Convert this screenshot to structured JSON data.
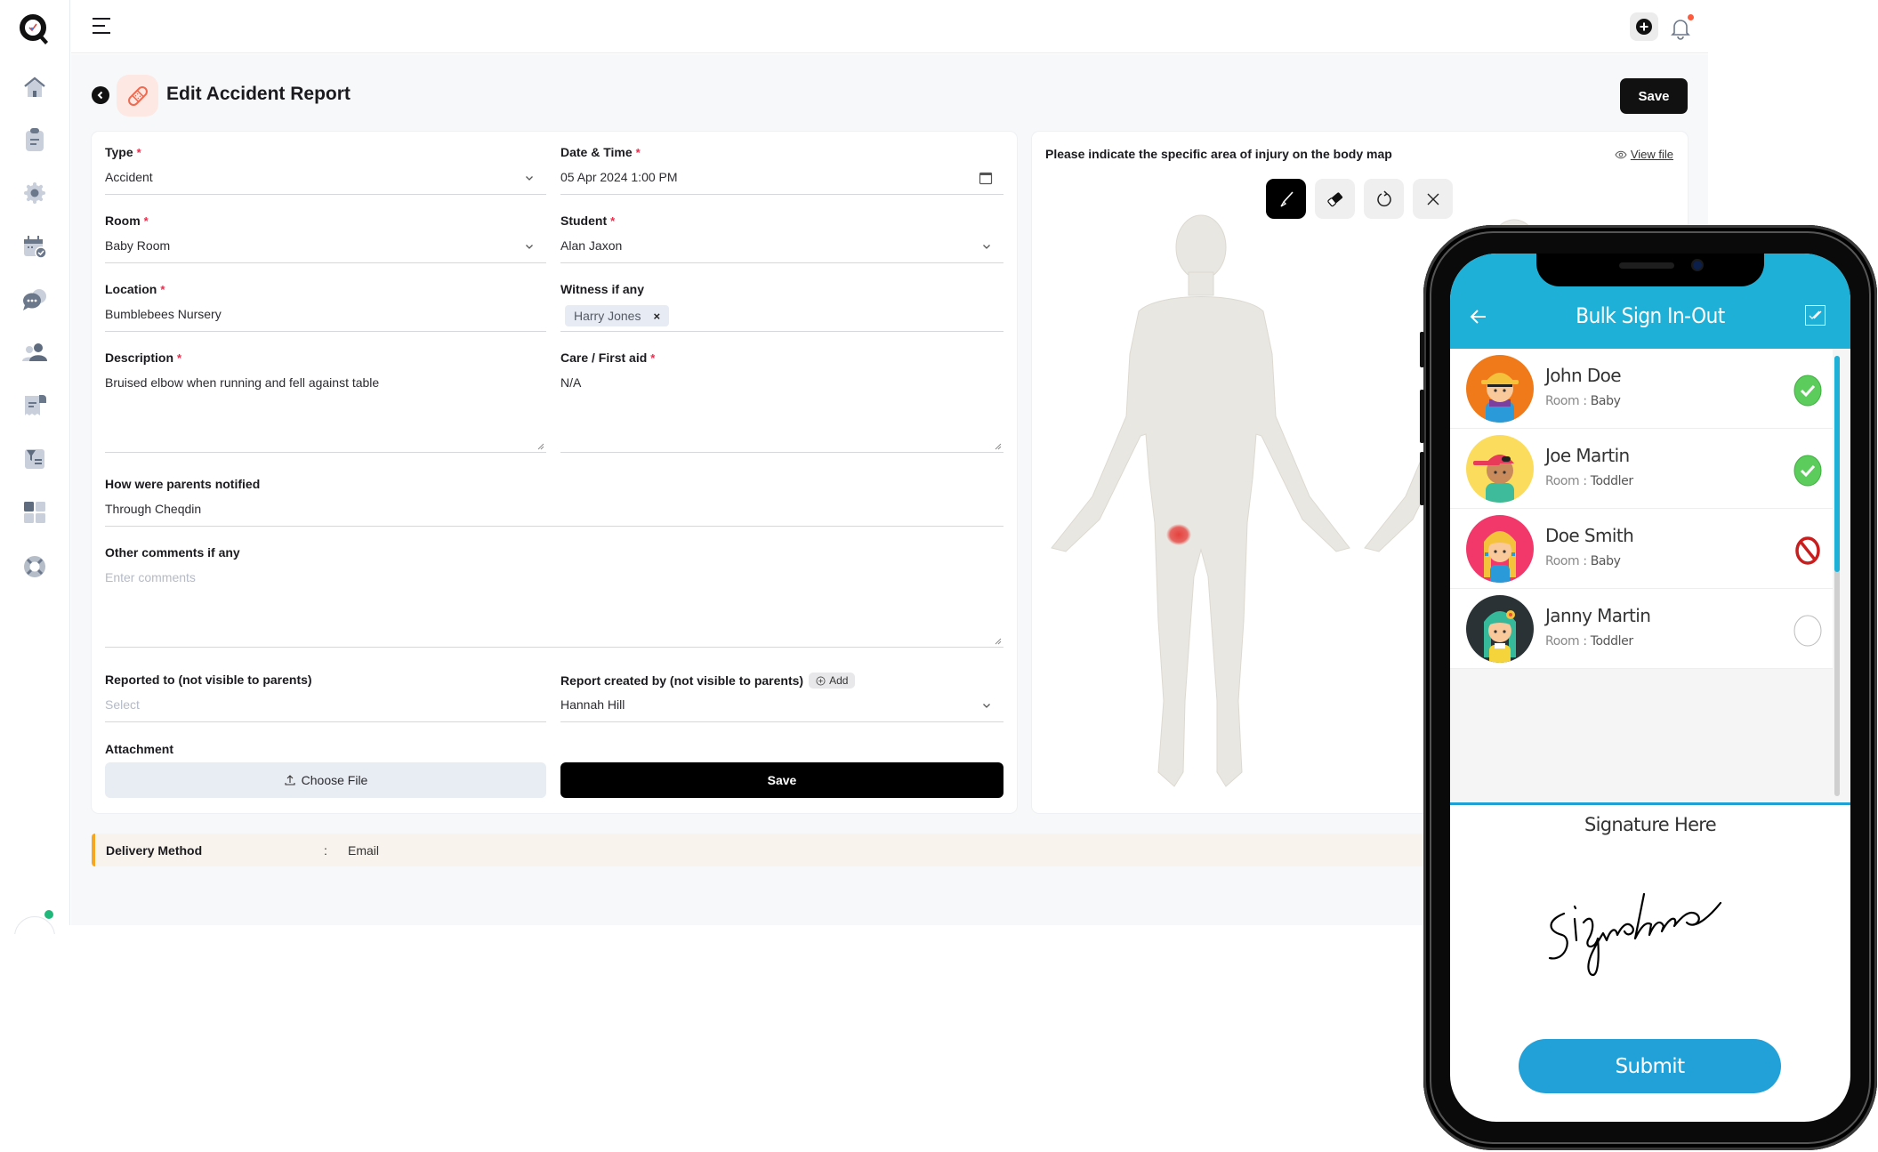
{
  "app": {
    "title": "Edit Accident Report",
    "sidebar": {
      "items": [
        {
          "icon": "home-icon"
        },
        {
          "icon": "clipboard-icon"
        },
        {
          "icon": "settings-icon"
        },
        {
          "icon": "calendar-check-icon"
        },
        {
          "icon": "chat-icon"
        },
        {
          "icon": "users-icon"
        },
        {
          "icon": "receipt-icon"
        },
        {
          "icon": "filter-list-icon"
        },
        {
          "icon": "dashboard-grid-icon"
        },
        {
          "icon": "support-lifebuoy-icon"
        }
      ]
    },
    "topbar": {
      "add_icon": "plus-circle-icon",
      "bell_icon": "bell-icon",
      "notification_dot": true
    },
    "header": {
      "save_label": "Save"
    }
  },
  "form": {
    "type": {
      "label": "Type",
      "required": "*",
      "value": "Accident"
    },
    "datetime": {
      "label": "Date & Time",
      "required": "*",
      "value": "05 Apr 2024 1:00 PM"
    },
    "room": {
      "label": "Room",
      "required": "*",
      "value": "Baby Room"
    },
    "student": {
      "label": "Student",
      "required": "*",
      "value": "Alan Jaxon"
    },
    "location": {
      "label": "Location",
      "required": "*",
      "value": "Bumblebees Nursery"
    },
    "witness": {
      "label": "Witness if any",
      "chips": [
        "Harry Jones"
      ],
      "chip_remove": "×"
    },
    "description": {
      "label": "Description",
      "required": "*",
      "value": "Bruised elbow when running and fell against table"
    },
    "care": {
      "label": "Care / First aid",
      "required": "*",
      "value": "N/A"
    },
    "parents_notified": {
      "label": "How were parents notified",
      "value": "Through Cheqdin"
    },
    "comments": {
      "label": "Other comments if any",
      "placeholder": "Enter comments",
      "value": ""
    },
    "reported_to": {
      "label": "Reported to (not visible to parents)",
      "placeholder": "Select",
      "value": ""
    },
    "created_by": {
      "label": "Report created by (not visible to parents)",
      "add_label": "Add",
      "value": "Hannah Hill"
    },
    "attachment": {
      "label": "Attachment",
      "choose_label": "Choose File"
    },
    "save_label": "Save"
  },
  "body_map": {
    "prompt": "Please indicate the specific area of injury on the body map",
    "view_file": "View file",
    "tools": [
      {
        "name": "brush",
        "active": true
      },
      {
        "name": "eraser",
        "active": false
      },
      {
        "name": "undo",
        "active": false
      },
      {
        "name": "clear",
        "active": false
      }
    ],
    "marker_color": "#e53935",
    "marker_location": "right knee (front view)"
  },
  "delivery": {
    "label": "Delivery Method",
    "separator": ":",
    "value": "Email"
  },
  "phone": {
    "title": "Bulk Sign In-Out",
    "room_prefix": "Room :",
    "kids": [
      {
        "name": "John Doe",
        "room": "Baby",
        "status": "signed-in"
      },
      {
        "name": "Joe Martin",
        "room": "Toddler",
        "status": "signed-in"
      },
      {
        "name": "Doe Smith",
        "room": "Baby",
        "status": "absent"
      },
      {
        "name": "Janny Martin",
        "room": "Toddler",
        "status": "not-signed"
      }
    ],
    "signature_label": "Signature Here",
    "signature_text": "signature",
    "submit_label": "Submit",
    "accent": "#1fb0d8"
  }
}
